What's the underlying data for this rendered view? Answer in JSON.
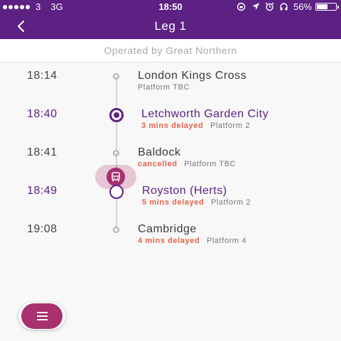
{
  "status_bar": {
    "carrier": "3",
    "network": "3G",
    "time": "18:50",
    "battery": "56%",
    "battery_level": 0.56
  },
  "nav": {
    "title": "Leg 1"
  },
  "operator": {
    "text": "Operated by Great Northern"
  },
  "stops": [
    {
      "time": "18:14",
      "name": "London Kings Cross",
      "status": "",
      "platform": "Platform TBC"
    },
    {
      "time": "18:40",
      "name": "Letchworth Garden City",
      "status": "3 mins delayed",
      "platform": "Platform 2"
    },
    {
      "time": "18:41",
      "name": "Baldock",
      "status": "cancelled",
      "platform": "Platform TBC"
    },
    {
      "time": "18:49",
      "name": "Royston (Herts)",
      "status": "5 mins delayed",
      "platform": "Platform 2"
    },
    {
      "time": "19:08",
      "name": "Cambridge",
      "status": "4 mins delayed",
      "platform": "Platform 4"
    }
  ],
  "colors": {
    "brand": "#5c2183",
    "accent": "#a8316e",
    "delay": "#e5624a"
  },
  "icons": {
    "back": "chevron-left-icon",
    "train": "train-icon",
    "menu": "menu-icon"
  }
}
